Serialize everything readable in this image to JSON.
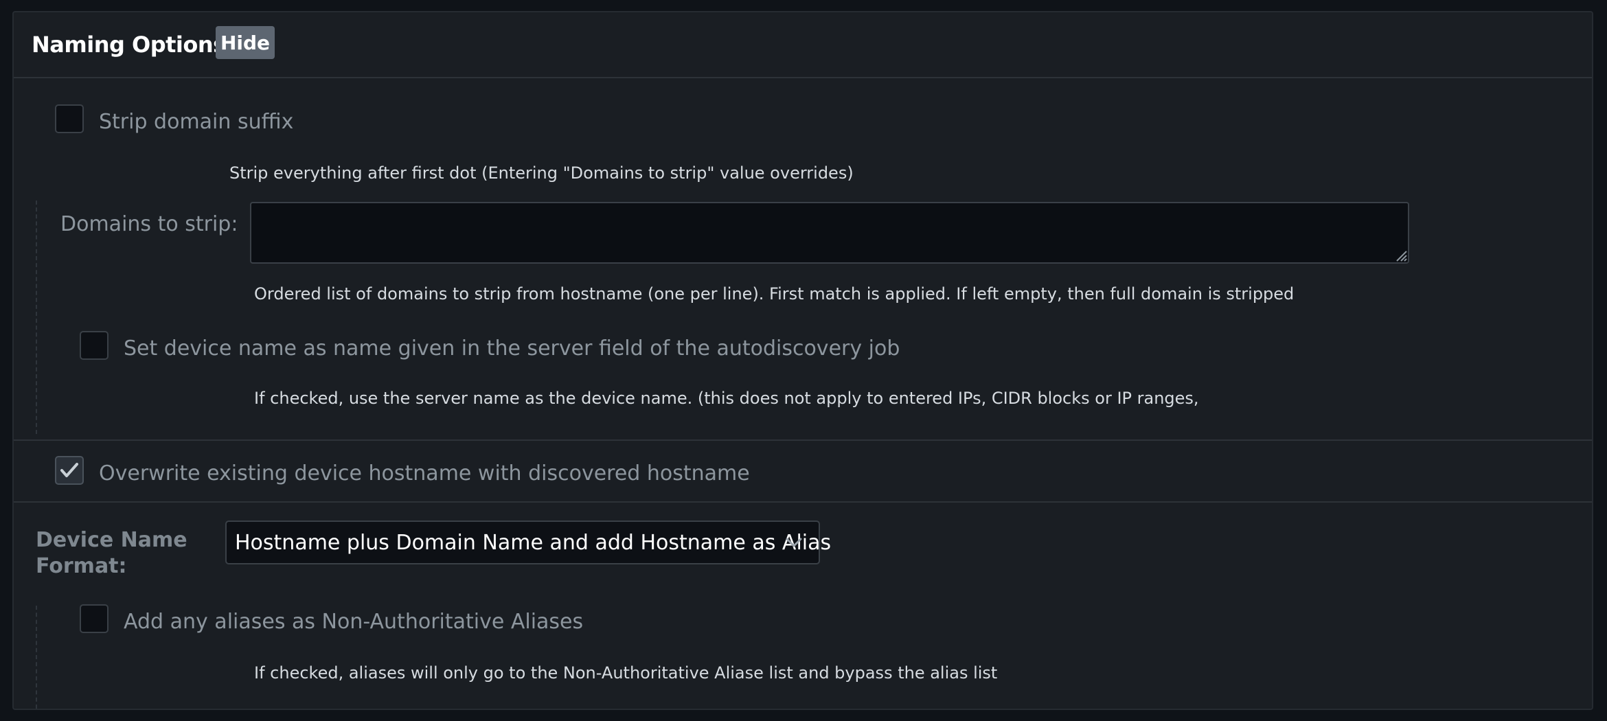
{
  "header": {
    "title": "Naming Options",
    "hide_label": "Hide"
  },
  "strip_domain": {
    "label": "Strip domain suffix",
    "checked": false,
    "help": "Strip everything after first dot (Entering \"Domains to strip\" value overrides)"
  },
  "domains_to_strip": {
    "label": "Domains to strip:",
    "value": "",
    "help": "Ordered list of domains to strip from hostname (one per line). First match is applied. If left empty, then full domain is stripped"
  },
  "server_name": {
    "label": "Set device name as name given in the server field of the autodiscovery job",
    "checked": false,
    "help": "If checked, use the server name as the device name. (this does not apply to entered IPs, CIDR blocks or IP ranges,"
  },
  "overwrite_hostname": {
    "label": "Overwrite existing device hostname with discovered hostname",
    "checked": true
  },
  "device_name_format": {
    "label_line1": "Device Name",
    "label_line2": "Format:",
    "selected": "Hostname plus Domain Name and add Hostname as Alias"
  },
  "aliases": {
    "label": "Add any aliases as Non-Authoritative Aliases",
    "checked": false,
    "help": "If checked, aliases will only go to the Non-Authoritative Aliase list and bypass the alias list"
  },
  "icons": {
    "check": "checkmark-icon",
    "chevron": "chevron-down-icon",
    "resize": "resize-grip-icon"
  }
}
